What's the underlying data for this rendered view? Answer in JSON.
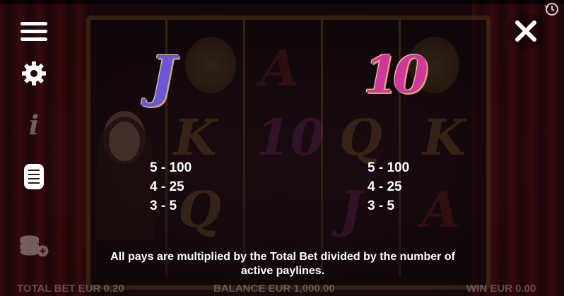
{
  "menu": {
    "menu_icon": "hamburger-menu-icon",
    "settings_icon": "gear-icon",
    "info_icon": "info-icon",
    "paytable_icon": "paytable-icon",
    "bet_icon": "coin-stack-icon"
  },
  "close_icon": "close-icon",
  "history_icon": "history-clock-icon",
  "paytable": {
    "symbols": [
      {
        "glyph": "J",
        "color": "#6b55d8",
        "pays": [
          "5 - 100",
          "4 - 25",
          "3 - 5"
        ]
      },
      {
        "glyph": "10",
        "color": "#d1359e",
        "pays": [
          "5 - 100",
          "4 - 25",
          "3 - 5"
        ]
      }
    ],
    "note_line1": "All pays are multiplied by the Total Bet divided by the number of",
    "note_line2": "active paylines."
  },
  "status": {
    "total_bet": "TOTAL BET EUR 0.20",
    "balance": "BALANCE EUR 1,000.00",
    "win": "WIN EUR 0.00"
  }
}
